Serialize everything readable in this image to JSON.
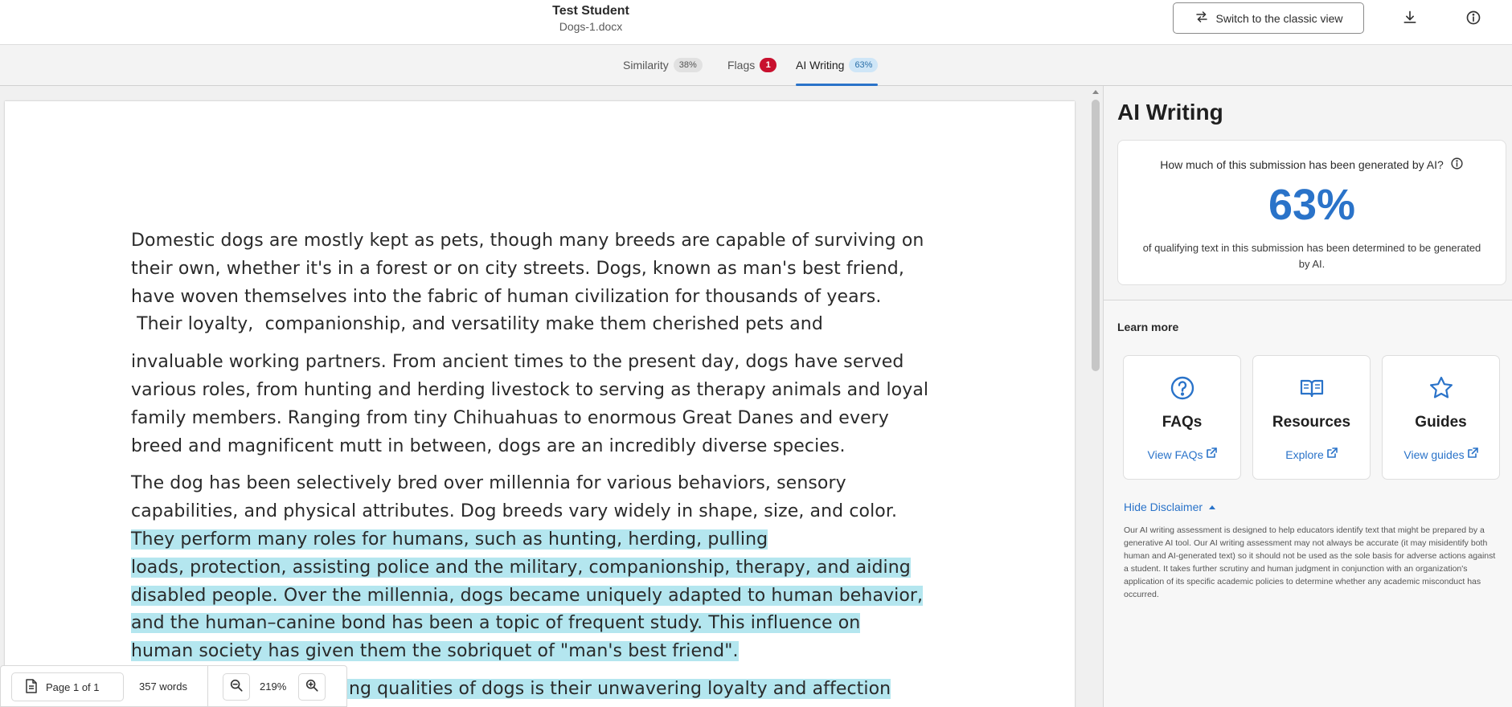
{
  "header": {
    "student_name": "Test Student",
    "file_name": "Dogs-1.docx",
    "classic_view_label": "Switch to the classic view",
    "download_icon": "download-icon",
    "info_icon": "info-icon"
  },
  "tabs": [
    {
      "label": "Similarity",
      "count": "38%"
    },
    {
      "label": "Flags",
      "count": "1"
    },
    {
      "label": "AI Writing",
      "count": "63%",
      "active": true
    }
  ],
  "document": {
    "paragraphs": [
      {
        "lines": [
          {
            "text": "Domestic dogs are mostly kept as pets,  though many breeds are capable of surviving on",
            "hl": false
          },
          {
            "text": "their own,  whether it's in a forest or on city streets.  Dogs,  known as man's best friend,",
            "hl": false
          },
          {
            "text": "have woven themselves into the fabric of human civilization for thousands of years.",
            "hl": false
          },
          {
            "text": " Their loyalty,  companionship, and versatility make them cherished pets and",
            "hl": false
          }
        ]
      },
      {
        "lines": [
          {
            "text": "invaluable working partners. From ancient times to the present day, dogs have served",
            "hl": false
          },
          {
            "text": "various roles, from hunting and herding livestock to serving as therapy animals and loyal",
            "hl": false
          },
          {
            "text": "family members. Ranging from tiny Chihuahuas to enormous Great Danes and every",
            "hl": false
          },
          {
            "text": "breed and magnificent mutt in between, dogs are an incredibly diverse species.",
            "hl": false
          }
        ]
      },
      {
        "lines": [
          {
            "text": "The dog has been selectively bred over millennia for various behaviors, sensory",
            "hl": false
          },
          {
            "text": "capabilities, and physical attributes. Dog breeds vary widely in shape, size, and color.",
            "hl": false
          },
          {
            "text": "They perform many roles for humans, such as hunting, herding, pulling",
            "hl": true
          },
          {
            "text": "loads, protection, assisting police and the military, companionship, therapy, and aiding",
            "hl": true
          },
          {
            "text": "disabled people. Over the millennia, dogs became uniquely adapted to human behavior,",
            "hl": true
          },
          {
            "text": "and the human–canine bond has been a topic of frequent study. This influence on",
            "hl": true
          },
          {
            "text": "human society has given them the sobriquet of \"man's best friend\".",
            "hl": true
          }
        ]
      },
      {
        "lines": [
          {
            "text": "One of the most endearing qualities of dogs is their unwavering loyalty and affection",
            "hl": true
          }
        ]
      }
    ]
  },
  "bottom_toolbar": {
    "page_indicator": "Page 1 of 1",
    "word_count": "357 words",
    "zoom_level": "219%"
  },
  "ai_panel": {
    "title": "AI Writing",
    "question": "How much of this submission has been generated by AI?",
    "score": "63%",
    "description": "of qualifying text in this submission has been determined to be generated by AI.",
    "learn_more_label": "Learn more",
    "resources": [
      {
        "title": "FAQs",
        "link": "View FAQs",
        "icon": "question-circle-icon"
      },
      {
        "title": "Resources",
        "link": "Explore",
        "icon": "open-book-icon"
      },
      {
        "title": "Guides",
        "link": "View guides",
        "icon": "star-icon"
      }
    ],
    "disclaimer_toggle": "Hide Disclaimer",
    "disclaimer_text": "Our AI writing assessment is designed to help educators identify text that might be prepared by a generative AI tool. Our AI writing assessment may not always be accurate (it may misidentify both human and AI-generated text) so it should not be used as the sole basis for adverse actions against a student. It takes further scrutiny and human judgment in conjunction with an organization's application of its specific academic policies to determine whether any academic misconduct has occurred."
  },
  "colors": {
    "accent": "#2a73c9",
    "highlight": "#b4e6ef",
    "flag_badge": "#c8102e"
  }
}
